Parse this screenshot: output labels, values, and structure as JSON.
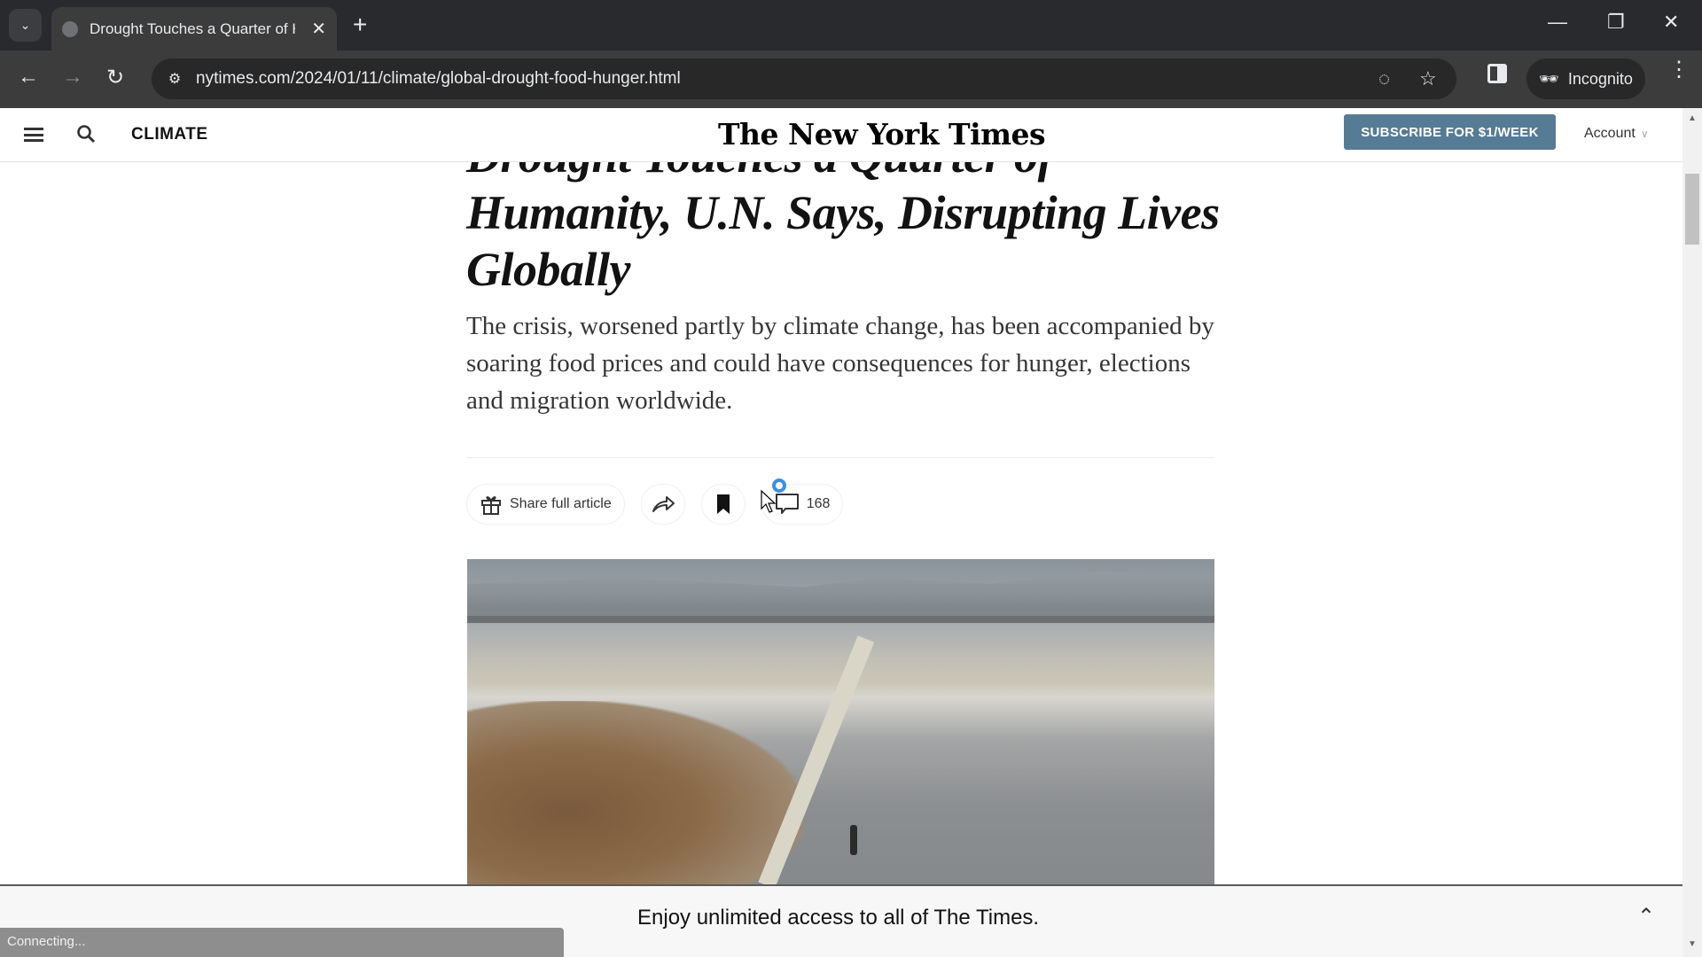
{
  "browser": {
    "tab_title": "Drought Touches a Quarter of Humanity",
    "url": "nytimes.com/2024/01/11/climate/global-drought-food-hunger.html",
    "incognito_label": "Incognito",
    "new_tab_glyph": "+",
    "close_glyph": "✕",
    "status_text": "Connecting..."
  },
  "nyt_header": {
    "section": "CLIMATE",
    "masthead": "The New York Times",
    "subscribe_label": "SUBSCRIBE FOR $1/WEEK",
    "account_label": "Account"
  },
  "article": {
    "headline": "Drought Touches a Quarter of Humanity, U.N. Says, Disrupting Lives Globally",
    "summary": "The crisis, worsened partly by climate change, has been accompanied by soaring food prices and could have consequences for hunger, elections and migration worldwide.",
    "share_full_label": "Share full article",
    "comments_count": "168"
  },
  "regwall": {
    "message": "Enjoy unlimited access to all of The Times."
  },
  "colors": {
    "subscribe_bg": "#567b95",
    "chrome_dark": "#292a2d",
    "toolbar": "#3c3c3c"
  }
}
